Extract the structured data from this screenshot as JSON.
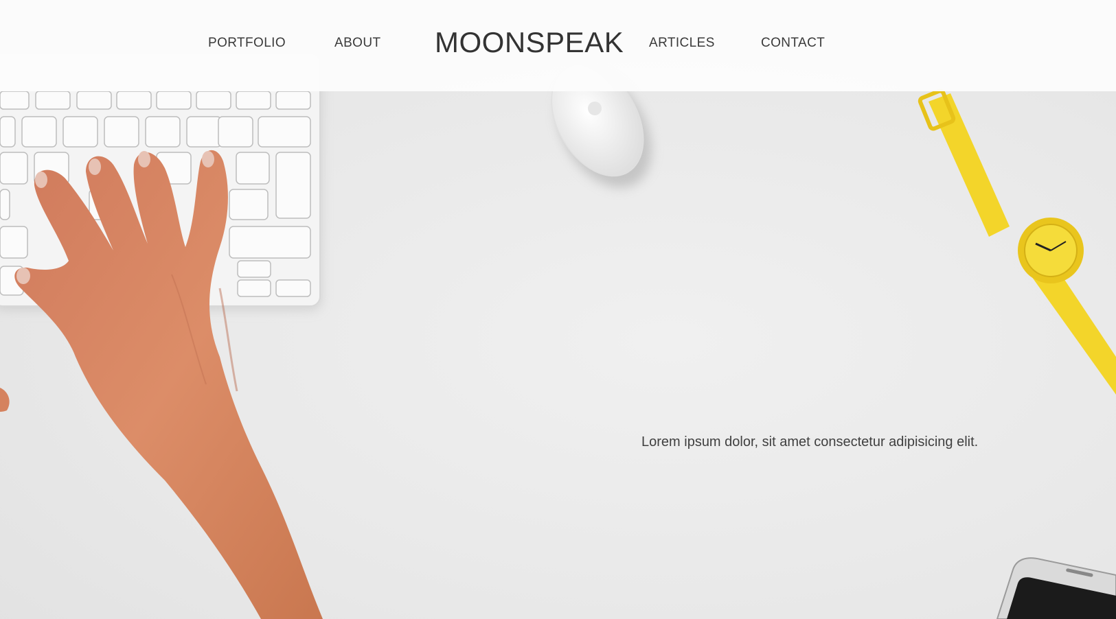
{
  "nav": {
    "links": [
      {
        "label": "PORTFOLIO"
      },
      {
        "label": "ABOUT"
      },
      {
        "label": "ARTICLES"
      },
      {
        "label": "CONTACT"
      }
    ],
    "brand": "MOONSPEAK"
  },
  "hero": {
    "tagline": "Lorem ipsum dolor, sit amet consectetur adipisicing elit.",
    "photo_objects": [
      "keyboard",
      "hand",
      "mouse",
      "wristwatch",
      "smartphone"
    ],
    "colors": {
      "background": "#ececec",
      "watch": "#f3d52a",
      "skin": "#d98a66",
      "text": "#3a3a3a"
    }
  }
}
